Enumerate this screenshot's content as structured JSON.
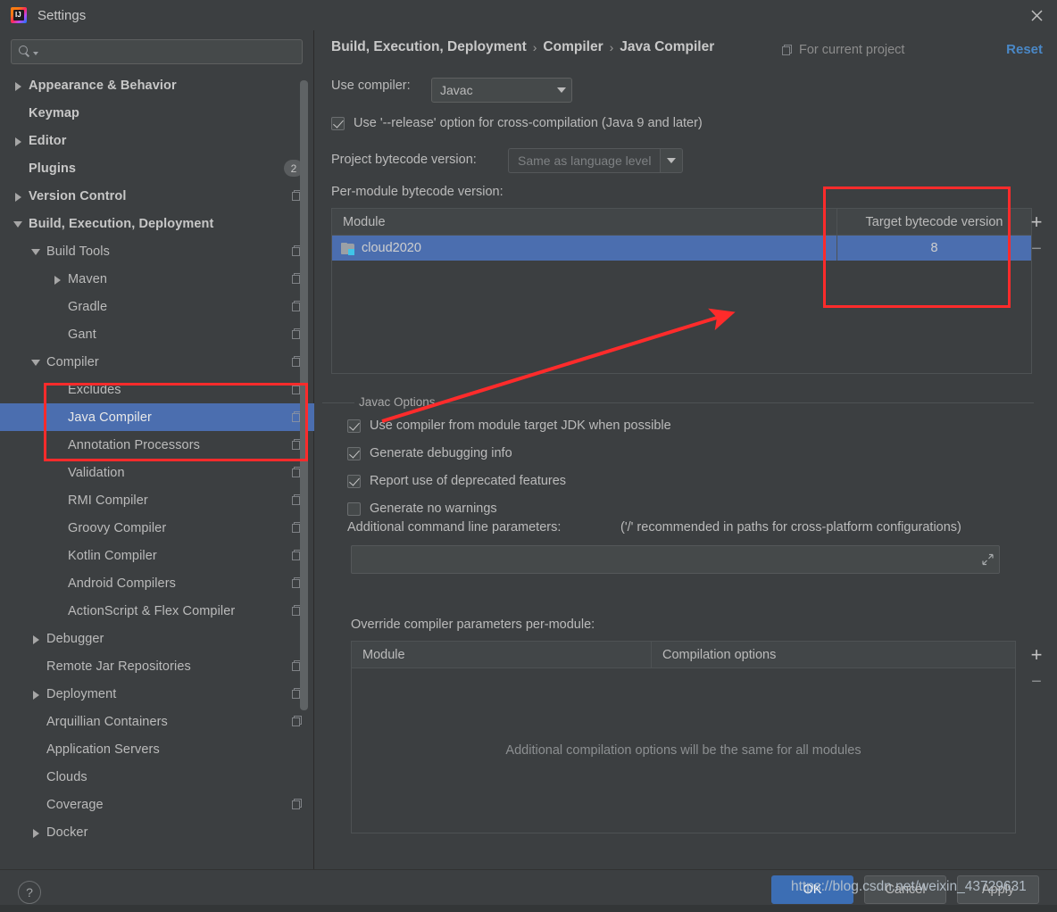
{
  "window": {
    "title": "Settings",
    "app_icon": "intellij-idea-icon",
    "close_icon": "close-icon"
  },
  "sidebar": {
    "search": {
      "placeholder": "",
      "value": "",
      "icon": "search-icon"
    },
    "items": [
      {
        "label": "Appearance & Behavior",
        "indent": 0,
        "twisty": "right",
        "bold": true,
        "copy": false,
        "badge": ""
      },
      {
        "label": "Keymap",
        "indent": 0,
        "twisty": "none",
        "bold": true,
        "copy": false,
        "badge": ""
      },
      {
        "label": "Editor",
        "indent": 0,
        "twisty": "right",
        "bold": true,
        "copy": false,
        "badge": ""
      },
      {
        "label": "Plugins",
        "indent": 0,
        "twisty": "none",
        "bold": true,
        "copy": false,
        "badge": "2"
      },
      {
        "label": "Version Control",
        "indent": 0,
        "twisty": "right",
        "bold": true,
        "copy": true,
        "badge": ""
      },
      {
        "label": "Build, Execution, Deployment",
        "indent": 0,
        "twisty": "down",
        "bold": true,
        "copy": false,
        "badge": ""
      },
      {
        "label": "Build Tools",
        "indent": 1,
        "twisty": "down",
        "bold": false,
        "copy": true,
        "badge": ""
      },
      {
        "label": "Maven",
        "indent": 2,
        "twisty": "right",
        "bold": false,
        "copy": true,
        "badge": ""
      },
      {
        "label": "Gradle",
        "indent": 2,
        "twisty": "none",
        "bold": false,
        "copy": true,
        "badge": ""
      },
      {
        "label": "Gant",
        "indent": 2,
        "twisty": "none",
        "bold": false,
        "copy": true,
        "badge": ""
      },
      {
        "label": "Compiler",
        "indent": 1,
        "twisty": "down",
        "bold": false,
        "copy": true,
        "badge": ""
      },
      {
        "label": "Excludes",
        "indent": 2,
        "twisty": "none",
        "bold": false,
        "copy": true,
        "badge": ""
      },
      {
        "label": "Java Compiler",
        "indent": 2,
        "twisty": "none",
        "bold": false,
        "copy": true,
        "badge": "",
        "selected": true
      },
      {
        "label": "Annotation Processors",
        "indent": 2,
        "twisty": "none",
        "bold": false,
        "copy": true,
        "badge": ""
      },
      {
        "label": "Validation",
        "indent": 2,
        "twisty": "none",
        "bold": false,
        "copy": true,
        "badge": ""
      },
      {
        "label": "RMI Compiler",
        "indent": 2,
        "twisty": "none",
        "bold": false,
        "copy": true,
        "badge": ""
      },
      {
        "label": "Groovy Compiler",
        "indent": 2,
        "twisty": "none",
        "bold": false,
        "copy": true,
        "badge": ""
      },
      {
        "label": "Kotlin Compiler",
        "indent": 2,
        "twisty": "none",
        "bold": false,
        "copy": true,
        "badge": ""
      },
      {
        "label": "Android Compilers",
        "indent": 2,
        "twisty": "none",
        "bold": false,
        "copy": true,
        "badge": ""
      },
      {
        "label": "ActionScript & Flex Compiler",
        "indent": 2,
        "twisty": "none",
        "bold": false,
        "copy": true,
        "badge": ""
      },
      {
        "label": "Debugger",
        "indent": 1,
        "twisty": "right",
        "bold": false,
        "copy": false,
        "badge": ""
      },
      {
        "label": "Remote Jar Repositories",
        "indent": 1,
        "twisty": "none",
        "bold": false,
        "copy": true,
        "badge": ""
      },
      {
        "label": "Deployment",
        "indent": 1,
        "twisty": "right",
        "bold": false,
        "copy": true,
        "badge": ""
      },
      {
        "label": "Arquillian Containers",
        "indent": 1,
        "twisty": "none",
        "bold": false,
        "copy": true,
        "badge": ""
      },
      {
        "label": "Application Servers",
        "indent": 1,
        "twisty": "none",
        "bold": false,
        "copy": false,
        "badge": ""
      },
      {
        "label": "Clouds",
        "indent": 1,
        "twisty": "none",
        "bold": false,
        "copy": false,
        "badge": ""
      },
      {
        "label": "Coverage",
        "indent": 1,
        "twisty": "none",
        "bold": false,
        "copy": true,
        "badge": ""
      },
      {
        "label": "Docker",
        "indent": 1,
        "twisty": "right",
        "bold": false,
        "copy": false,
        "badge": ""
      }
    ]
  },
  "header": {
    "breadcrumb": [
      "Build, Execution, Deployment",
      "Compiler",
      "Java Compiler"
    ],
    "separator": "›",
    "for_project_label": "For current project",
    "for_project_icon": "copy-icon",
    "reset_label": "Reset"
  },
  "main": {
    "use_compiler_label": "Use compiler:",
    "use_compiler_value": "Javac",
    "release_option_label": "Use '--release' option for cross-compilation (Java 9 and later)",
    "release_option_checked": true,
    "project_bytecode_label": "Project bytecode version:",
    "project_bytecode_value": "Same as language level",
    "per_module_label": "Per-module bytecode version:",
    "module_table": {
      "columns": [
        "Module",
        "Target bytecode version"
      ],
      "rows": [
        {
          "module": "cloud2020",
          "target": "8",
          "selected": true,
          "icon": "module-folder-icon"
        }
      ],
      "add_button": "+",
      "remove_button": "−"
    },
    "javac_group_title": "Javac Options",
    "javac_options": [
      {
        "label": "Use compiler from module target JDK when possible",
        "checked": true
      },
      {
        "label": "Generate debugging info",
        "checked": true
      },
      {
        "label": "Report use of deprecated features",
        "checked": true
      },
      {
        "label": "Generate no warnings",
        "checked": false
      }
    ],
    "additional_params_label": "Additional command line parameters:",
    "additional_params_hint": "('/' recommended in paths for cross-platform configurations)",
    "additional_params_value": "",
    "override_label": "Override compiler parameters per-module:",
    "override_table": {
      "columns": [
        "Module",
        "Compilation options"
      ],
      "empty_message": "Additional compilation options will be the same for all modules",
      "add_button": "+",
      "remove_button": "−"
    }
  },
  "footer": {
    "help_label": "?",
    "ok_label": "OK",
    "cancel_label": "Cancel",
    "apply_label": "Apply",
    "watermark": "https://blog.csdn.net/weixin_43729631"
  },
  "annotations": {
    "color": "#FF2B2B",
    "rect_sidebar": "highlights Excludes / Java Compiler / Annotation Processors",
    "rect_table": "highlights Target bytecode version column",
    "arrow": "points from Javac Options to Target bytecode version"
  }
}
